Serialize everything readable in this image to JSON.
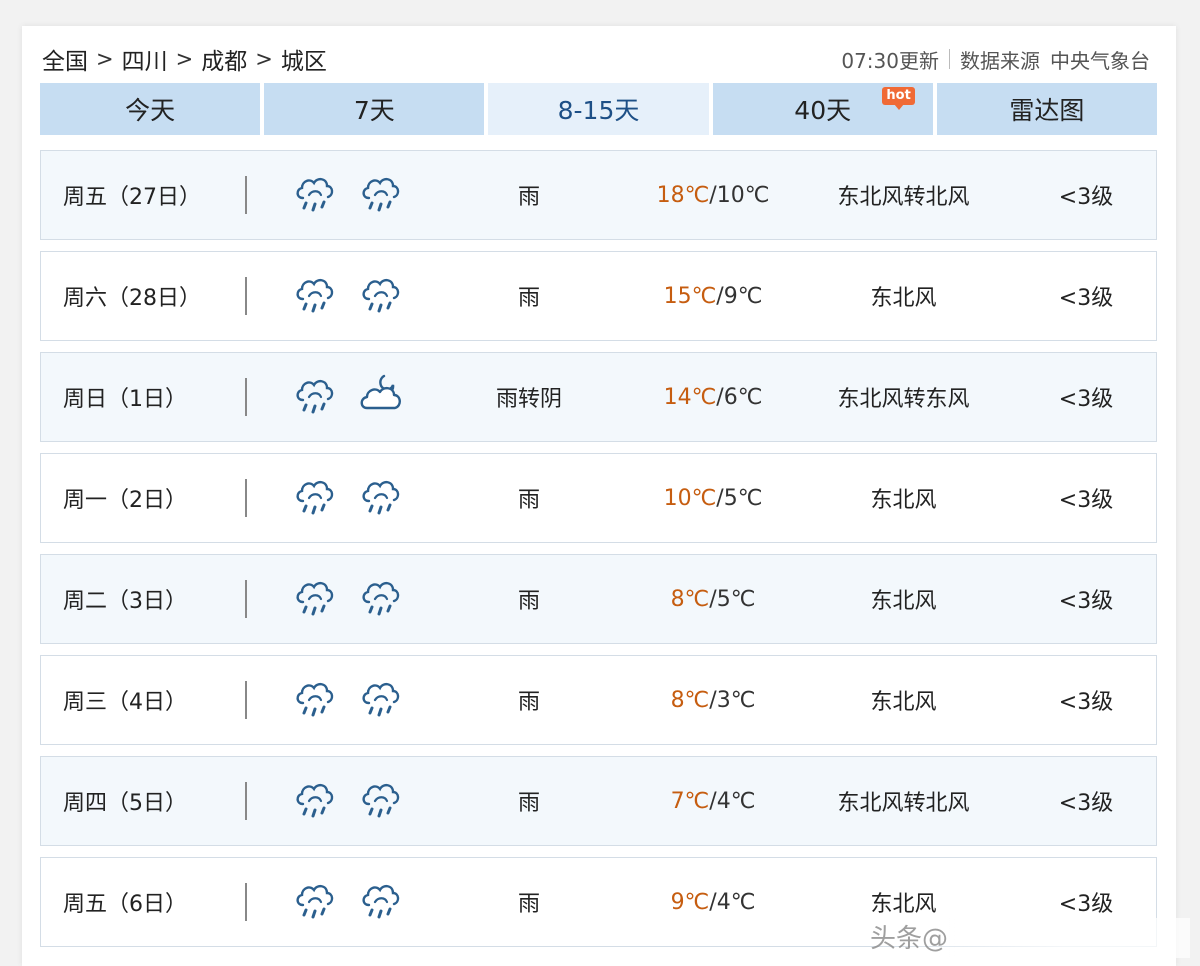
{
  "breadcrumb": {
    "items": [
      "全国",
      "四川",
      "成都",
      "城区"
    ],
    "separator": ">"
  },
  "meta": {
    "updated": "07:30更新",
    "source_label": "数据来源",
    "source": "中央气象台"
  },
  "tabs": [
    {
      "label": "今天",
      "active": false
    },
    {
      "label": "7天",
      "active": false
    },
    {
      "label": "8-15天",
      "active": true
    },
    {
      "label": "40天",
      "active": false,
      "badge": "hot"
    },
    {
      "label": "雷达图",
      "active": false
    }
  ],
  "forecast": [
    {
      "day": "周五（27日）",
      "icon1": "rain-cloud-icon",
      "icon2": "rain-cloud-icon",
      "desc": "雨",
      "hi": "18℃",
      "lo": "10℃",
      "wind": "东北风转北风",
      "level": "<3级"
    },
    {
      "day": "周六（28日）",
      "icon1": "rain-cloud-icon",
      "icon2": "rain-cloud-icon",
      "desc": "雨",
      "hi": "15℃",
      "lo": "9℃",
      "wind": "东北风",
      "level": "<3级"
    },
    {
      "day": "周日（1日）",
      "icon1": "rain-cloud-icon",
      "icon2": "overcast-moon-icon",
      "desc": "雨转阴",
      "hi": "14℃",
      "lo": "6℃",
      "wind": "东北风转东风",
      "level": "<3级"
    },
    {
      "day": "周一（2日）",
      "icon1": "rain-cloud-icon",
      "icon2": "rain-cloud-icon",
      "desc": "雨",
      "hi": "10℃",
      "lo": "5℃",
      "wind": "东北风",
      "level": "<3级"
    },
    {
      "day": "周二（3日）",
      "icon1": "rain-cloud-icon",
      "icon2": "rain-cloud-icon",
      "desc": "雨",
      "hi": "8℃",
      "lo": "5℃",
      "wind": "东北风",
      "level": "<3级"
    },
    {
      "day": "周三（4日）",
      "icon1": "rain-cloud-icon",
      "icon2": "rain-cloud-icon",
      "desc": "雨",
      "hi": "8℃",
      "lo": "3℃",
      "wind": "东北风",
      "level": "<3级"
    },
    {
      "day": "周四（5日）",
      "icon1": "rain-cloud-icon",
      "icon2": "rain-cloud-icon",
      "desc": "雨",
      "hi": "7℃",
      "lo": "4℃",
      "wind": "东北风转北风",
      "level": "<3级"
    },
    {
      "day": "周五（6日）",
      "icon1": "rain-cloud-icon",
      "icon2": "rain-cloud-icon",
      "desc": "雨",
      "hi": "9℃",
      "lo": "4℃",
      "wind": "东北风",
      "level": "<3级"
    }
  ],
  "colors": {
    "tab_bg": "#c6ddf2",
    "tab_active_bg": "#e6f0fa",
    "tab_active_text": "#1d4f86",
    "high_temp": "#c65d10",
    "icon_stroke": "#2b5f8e",
    "hot_badge": "#f06a36"
  },
  "watermark": "头条@"
}
